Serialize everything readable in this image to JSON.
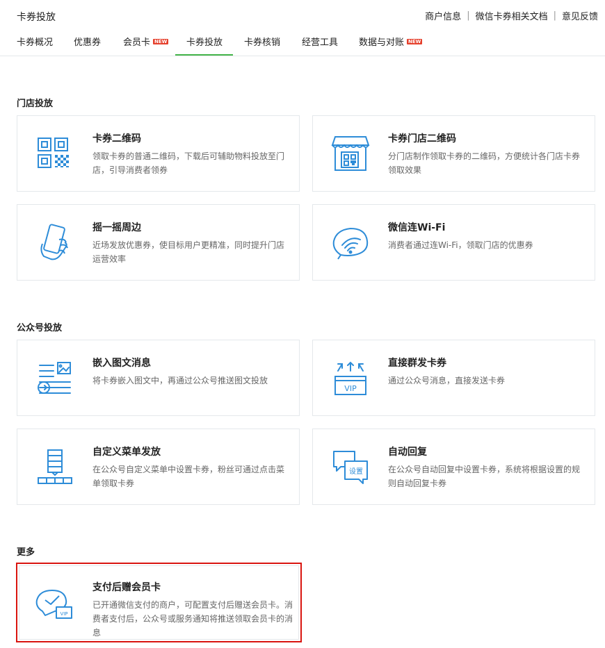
{
  "header": {
    "title": "卡券投放",
    "links": [
      "商户信息",
      "微信卡券相关文档",
      "意见反馈"
    ]
  },
  "tabs": [
    {
      "label": "卡券概况",
      "new": false
    },
    {
      "label": "优惠券",
      "new": false
    },
    {
      "label": "会员卡",
      "new": true
    },
    {
      "label": "卡券投放",
      "new": false,
      "active": true
    },
    {
      "label": "卡券核销",
      "new": false
    },
    {
      "label": "经营工具",
      "new": false
    },
    {
      "label": "数据与对账",
      "new": true
    }
  ],
  "new_badge": "NEW",
  "accent_color": "#44b549",
  "icon_color": "#2d8cd8",
  "highlight_color": "#d9140f",
  "sections": {
    "store": {
      "title": "门店投放",
      "cards": [
        {
          "title": "卡券二维码",
          "desc": "领取卡券的普通二维码，下载后可辅助物料投放至门店，引导消费者领券",
          "icon": "qrcode-icon"
        },
        {
          "title": "卡券门店二维码",
          "desc": "分门店制作领取卡券的二维码，方便统计各门店卡券领取效果",
          "icon": "store-qrcode-icon"
        },
        {
          "title": "摇一摇周边",
          "desc": "近场发放优惠券，使目标用户更精准，同时提升门店运营效率",
          "icon": "shake-icon"
        },
        {
          "title": "微信连Wi-Fi",
          "desc": "消费者通过连Wi-Fi，领取门店的优惠券",
          "icon": "wifi-icon"
        }
      ]
    },
    "official": {
      "title": "公众号投放",
      "cards": [
        {
          "title": "嵌入图文消息",
          "desc": "将卡券嵌入图文中，再通过公众号推送图文投放",
          "icon": "article-icon"
        },
        {
          "title": "直接群发卡券",
          "desc": "通过公众号消息，直接发送卡券",
          "icon": "broadcast-vip-icon",
          "icon_text": "VIP"
        },
        {
          "title": "自定义菜单发放",
          "desc": "在公众号自定义菜单中设置卡券，粉丝可通过点击菜单领取卡券",
          "icon": "menu-icon"
        },
        {
          "title": "自动回复",
          "desc": "在公众号自动回复中设置卡券，系统将根据设置的规则自动回复卡券",
          "icon": "auto-reply-icon",
          "icon_text": "设置"
        }
      ]
    },
    "more": {
      "title": "更多",
      "cards": [
        {
          "title": "支付后赠会员卡",
          "desc": "已开通微信支付的商户，可配置支付后赠送会员卡。消费者支付后，公众号或服务通知将推送领取会员卡的消息",
          "icon": "pay-vip-card-icon",
          "icon_text": "VIP"
        }
      ]
    }
  }
}
